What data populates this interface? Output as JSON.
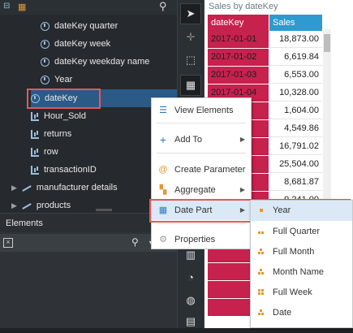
{
  "tree": {
    "items": [
      {
        "label": "dateKey quarter",
        "icon": "clock-icon"
      },
      {
        "label": "dateKey week",
        "icon": "clock-icon"
      },
      {
        "label": "dateKey weekday name",
        "icon": "clock-icon"
      },
      {
        "label": "Year",
        "icon": "clock-icon"
      },
      {
        "label": "dateKey",
        "icon": "clock-icon"
      },
      {
        "label": "Hour_Sold",
        "icon": "bar-icon"
      },
      {
        "label": "returns",
        "icon": "bar-icon"
      },
      {
        "label": "row",
        "icon": "bar-icon"
      },
      {
        "label": "transactionID",
        "icon": "bar-icon"
      },
      {
        "label": "manufacturer details",
        "icon": "line-icon"
      },
      {
        "label": "products",
        "icon": "line-icon"
      }
    ]
  },
  "elements_panel": {
    "title": "Elements"
  },
  "table": {
    "title": "Sales by dateKey",
    "headers": [
      "dateKey",
      "Sales"
    ],
    "rows": [
      [
        "2017-01-01",
        "18,873.00"
      ],
      [
        "2017-01-02",
        "6,619.84"
      ],
      [
        "2017-01-03",
        "6,553.00"
      ],
      [
        "2017-01-04",
        "10,328.00"
      ],
      [
        "",
        "1,604.00"
      ],
      [
        "",
        "4,549.86"
      ],
      [
        "",
        "16,791.02"
      ],
      [
        "",
        "25,504.00"
      ],
      [
        "",
        "8,681.87"
      ],
      [
        "",
        "9,241.00"
      ]
    ]
  },
  "context_menu": {
    "items": [
      {
        "label": "View Elements",
        "icon": "view-elements-icon",
        "has_submenu": false
      },
      {
        "label": "Add To",
        "icon": "plus-icon",
        "has_submenu": true
      },
      {
        "label": "Create Parameter",
        "icon": "at-icon",
        "has_submenu": false
      },
      {
        "label": "Aggregate",
        "icon": "aggregate-icon",
        "has_submenu": true
      },
      {
        "label": "Date Part",
        "icon": "calendar-icon",
        "has_submenu": true
      },
      {
        "label": "Properties",
        "icon": "gear-icon",
        "has_submenu": false
      }
    ],
    "active": "Date Part"
  },
  "date_part_submenu": {
    "items": [
      "Year",
      "Full Quarter",
      "Full Month",
      "Month Name",
      "Full Week",
      "Date"
    ],
    "active": "Year"
  },
  "colors": {
    "key_column": "#c7214e",
    "sales_header": "#2e9ad0",
    "selection": "#2b5a86",
    "highlight_outline": "#e05a5a",
    "menu_icon_orange": "#e5972f"
  }
}
